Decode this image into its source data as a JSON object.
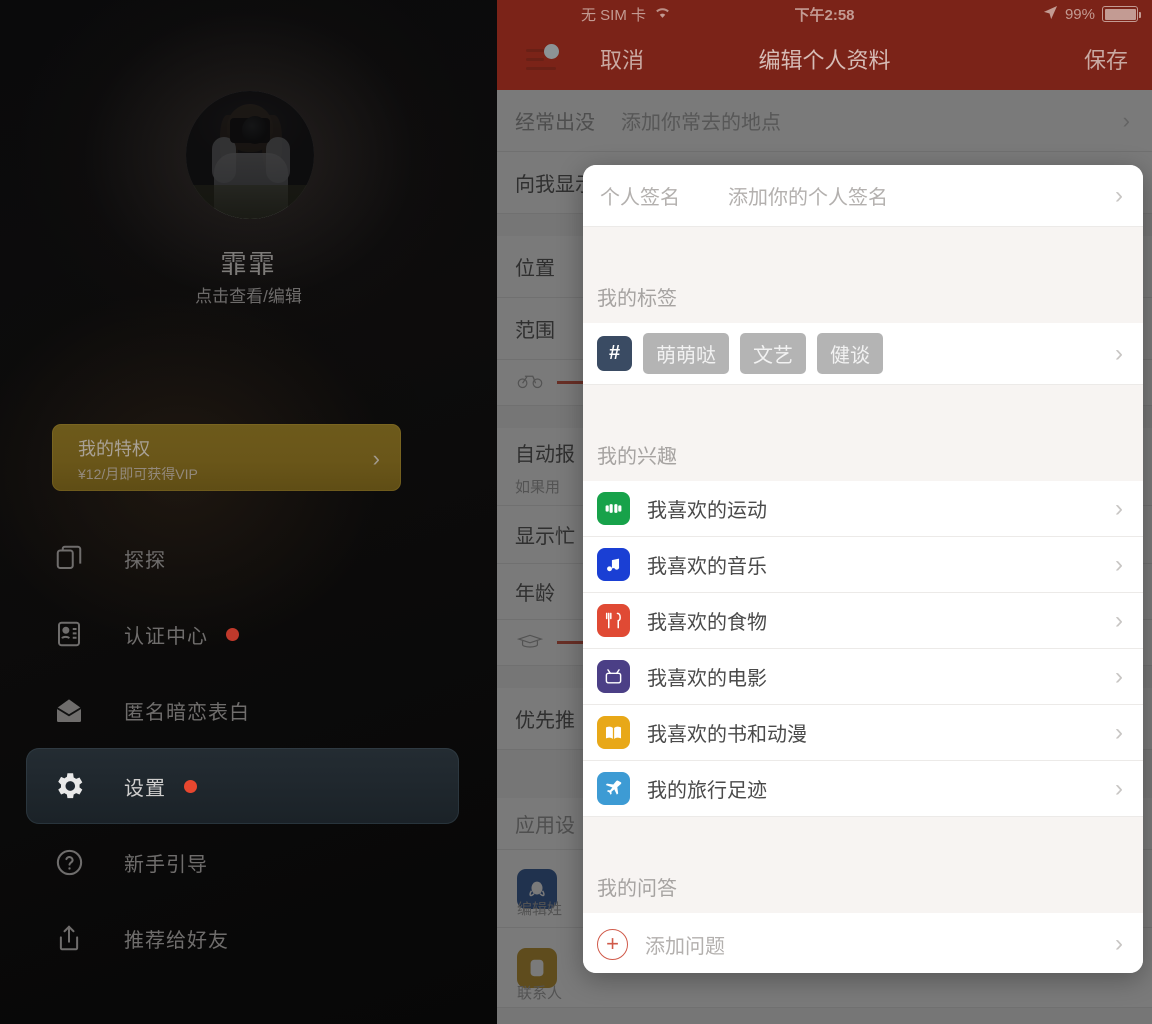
{
  "drawer": {
    "profile": {
      "name": "霏霏",
      "subtitle": "点击查看/编辑",
      "avatar_icon": "user-avatar-photo"
    },
    "vip_banner": {
      "title": "我的特权",
      "subtitle": "¥12/月即可获得VIP",
      "chevron": "›",
      "color": "#6a5619"
    },
    "nav_items": [
      {
        "label": "探探",
        "icon": "cards-icon",
        "badge": false,
        "active": false
      },
      {
        "label": "认证中心",
        "icon": "id-card-icon",
        "badge": true,
        "active": false
      },
      {
        "label": "匿名暗恋表白",
        "icon": "envelope-icon",
        "badge": false,
        "active": false
      },
      {
        "label": "设置",
        "icon": "gear-icon",
        "badge": true,
        "active": true
      },
      {
        "label": "新手引导",
        "icon": "question-circle-icon",
        "badge": false,
        "active": false
      },
      {
        "label": "推荐给好友",
        "icon": "share-icon",
        "badge": false,
        "active": false
      }
    ]
  },
  "statusbar": {
    "carrier": "无 SIM 卡",
    "wifi_icon": "wifi-icon",
    "time": "下午2:58",
    "location_icon": "location-arrow-icon",
    "battery_percent": "99%",
    "battery_icon": "battery-icon"
  },
  "navbar": {
    "menu_icon": "hamburger-menu-icon",
    "cancel_label": "取消",
    "title": "编辑个人资料",
    "save_label": "保存",
    "background_color": "#7b2318"
  },
  "background_form": {
    "rows": [
      {
        "label": "向我显示",
        "value": "",
        "type": "row"
      },
      {
        "label": "位置",
        "value": "",
        "type": "row"
      },
      {
        "label": "范围",
        "value": "",
        "type": "row"
      },
      {
        "label": "自动报",
        "value": "",
        "sub": "如果用",
        "type": "row"
      },
      {
        "label": "显示忙",
        "value": "",
        "type": "row"
      },
      {
        "label": "年龄",
        "value": "",
        "type": "row"
      },
      {
        "label": "优先推",
        "value": "",
        "type": "row"
      },
      {
        "label": "应用设",
        "value": "",
        "type": "row"
      },
      {
        "label": "编辑姓",
        "value": "",
        "type": "row"
      },
      {
        "label": "联系人",
        "value": "",
        "type": "row"
      }
    ],
    "top_row": {
      "key": "经常出没",
      "placeholder": "添加你常去的地点",
      "chevron": "›"
    }
  },
  "modal": {
    "signature_row": {
      "key": "个人签名",
      "placeholder": "添加你的个人签名",
      "chevron": "›"
    },
    "tags_section": {
      "header": "我的标签",
      "hash_icon": "hash-icon",
      "chevron": "›",
      "tags": [
        "萌萌哒",
        "文艺",
        "健谈"
      ]
    },
    "interests_section": {
      "header": "我的兴趣",
      "items": [
        {
          "label": "我喜欢的运动",
          "icon": "dumbbell-icon",
          "color": "#17a24a",
          "glyph": "sport",
          "chevron": "›"
        },
        {
          "label": "我喜欢的音乐",
          "icon": "music-note-icon",
          "color": "#1a3fd4",
          "glyph": "music",
          "chevron": "›"
        },
        {
          "label": "我喜欢的食物",
          "icon": "fork-spoon-icon",
          "color": "#e04a34",
          "glyph": "food",
          "chevron": "›"
        },
        {
          "label": "我喜欢的电影",
          "icon": "tv-icon",
          "color": "#4b3f86",
          "glyph": "tv",
          "chevron": "›"
        },
        {
          "label": "我喜欢的书和动漫",
          "icon": "book-icon",
          "color": "#e8a818",
          "glyph": "book",
          "chevron": "›"
        },
        {
          "label": "我的旅行足迹",
          "icon": "airplane-icon",
          "color": "#3d9bd4",
          "glyph": "plane",
          "chevron": "›"
        }
      ]
    },
    "qa_section": {
      "header": "我的问答",
      "add_label": "添加问题",
      "add_icon": "plus-circle-icon",
      "chevron": "›"
    }
  }
}
